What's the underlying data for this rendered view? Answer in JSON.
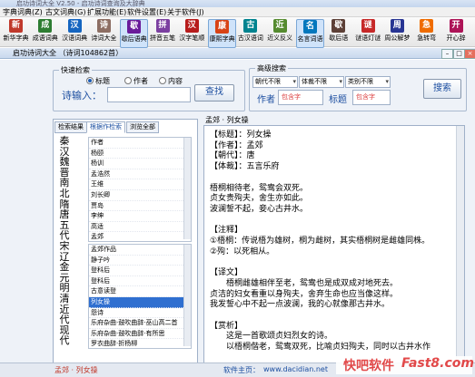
{
  "window": {
    "title": "启功诗词大全 V2.50 - 启功诗词查询及大辞典"
  },
  "menu": [
    "字典词典(Z)",
    "古文词典(G)",
    "扩展功能(E)",
    "软件设置(E)",
    "关于软件(J)"
  ],
  "toolbar": [
    {
      "label": "新华字典",
      "icon": "book-icon",
      "color": "#c0392b"
    },
    {
      "label": "成语词典",
      "icon": "book-icon",
      "color": "#2e7d32"
    },
    {
      "label": "汉语词典",
      "icon": "book-icon",
      "color": "#1565c0"
    },
    {
      "label": "诗词大全",
      "icon": "scroll-icon",
      "color": "#8d6e63"
    },
    {
      "label": "歇后语典",
      "icon": "book-icon",
      "color": "#6a1b9a",
      "active": true
    },
    {
      "label": "拼音五笔",
      "icon": "keyboard-icon",
      "color": "#7b3fa0"
    },
    {
      "label": "汉字笔顺",
      "icon": "brush-icon",
      "color": "#b71c1c"
    },
    {
      "label": "康熙字典",
      "icon": "book-icon",
      "color": "#d84315",
      "active": true
    },
    {
      "label": "古汉语词",
      "icon": "book-icon",
      "color": "#00838f"
    },
    {
      "label": "近义反义",
      "icon": "book-icon",
      "color": "#558b2f"
    },
    {
      "label": "名言词语",
      "icon": "quote-icon",
      "color": "#0277bd",
      "active": true
    },
    {
      "label": "歇后语",
      "icon": "book-icon",
      "color": "#5d4037"
    },
    {
      "label": "谜语灯谜",
      "icon": "lantern-icon",
      "color": "#c62828"
    },
    {
      "label": "周公解梦",
      "icon": "moon-icon",
      "color": "#283593"
    },
    {
      "label": "急转弯",
      "icon": "smile-icon",
      "color": "#ef6c00"
    },
    {
      "label": "开心辞",
      "icon": "star-icon",
      "color": "#ad1457"
    }
  ],
  "subwindow": {
    "title": "启功诗词大全 （诗词104862首）"
  },
  "quick": {
    "legend": "快速检索",
    "radios": [
      {
        "label": "标题",
        "checked": true
      },
      {
        "label": "作者",
        "checked": false
      },
      {
        "label": "内容",
        "checked": false
      }
    ],
    "input_label": "诗输入：",
    "search_button": "查找"
  },
  "advanced": {
    "legend": "高级搜索",
    "selects": [
      "朝代不限",
      "体裁不限",
      "类别不限"
    ],
    "author_label": "作者",
    "author_placeholder": "包含字",
    "title_label": "标题",
    "title_placeholder": "包含字",
    "search_button": "搜索"
  },
  "tabs": [
    "检索结果",
    "根据作检索",
    "浏览全部"
  ],
  "dynasties": [
    "秦",
    "汉",
    "魏晋",
    "南北",
    "隋",
    "唐",
    "五代",
    "宋",
    "辽",
    "金",
    "元",
    "明",
    "清",
    "近代",
    "现代"
  ],
  "author_list": [
    "作者",
    "杨颐",
    "杨训",
    "孟浩然",
    "王维",
    "刘长卿",
    "贾岛",
    "李绅",
    "高适",
    "孟郊"
  ],
  "works_list": [
    "孟郊作品",
    "静子吟",
    "登科后",
    "登科后",
    "古意读登",
    "列女操",
    "怨诗",
    "乐府杂曲·鼓吹曲辞·巫山高二首",
    "乐府杂曲·鼓吹曲辞·有所思",
    "罗衣曲辞·折杨柳"
  ],
  "selected_work_index": 5,
  "poem": {
    "header": "孟郊 · 列女操",
    "lines": [
      "【标题】：列女操",
      "【作者】：孟郊",
      "【朝代】：唐",
      "【体裁】：五言乐府",
      "",
      "梧桐相待老，鸳鸯会双死。",
      "贞女贵殉夫，舍生亦如此。",
      "波澜誓不起，妾心古井水。",
      "",
      "【注释】",
      "①梧桐：传说梧为雄树，桐为雌树，其实梧桐树是雌雄同株。",
      "②殉：以死相从。",
      "",
      "【译文】",
      "　　梧桐雌雄相伴至老，鸳鸯也是成双成对地死去。",
      "贞洁的妇女看重以身殉夫，舍弃生命也应当像这样。",
      "我发誓心中不起一点波澜，我的心就像那古井水。",
      "",
      "【赏析】",
      "　　这是一首歌颂贞妇烈女的诗。",
      "　　以梧桐偕老，鸳鸯双死，比喻贞妇殉夫，同时以古井水作"
    ]
  },
  "status": {
    "left": "孟郊 · 列女操",
    "center_label": "软件主页：",
    "center_url": "www.dacidian.net"
  },
  "watermark": {
    "text1": "快吧软件",
    "text2": "Fast8.com"
  }
}
